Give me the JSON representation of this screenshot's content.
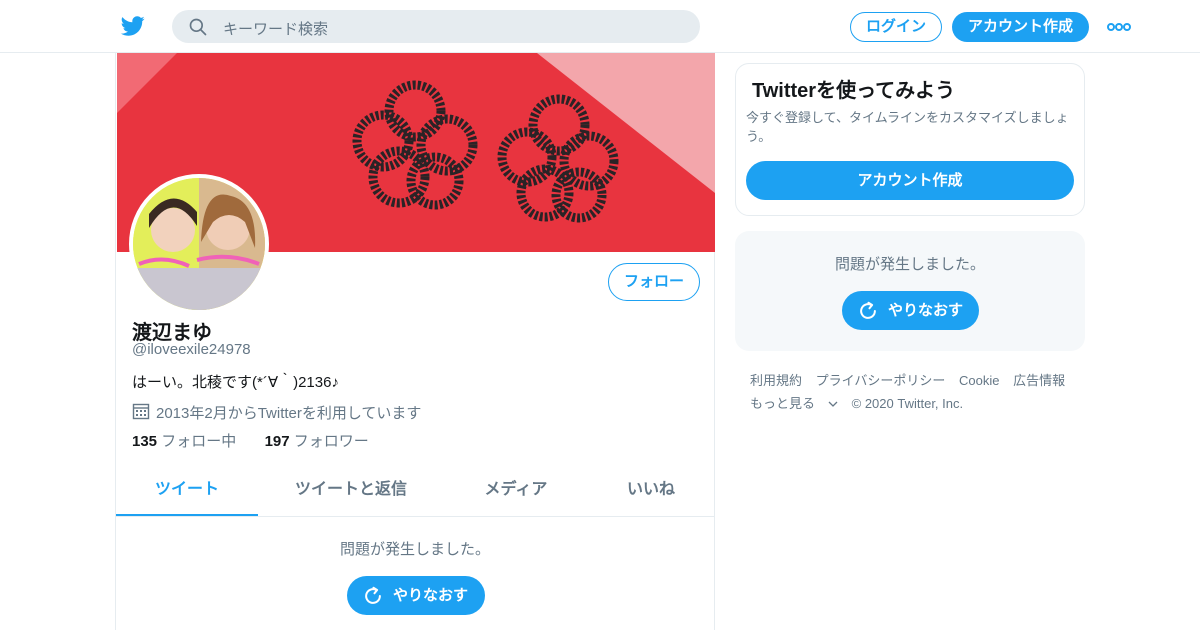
{
  "nav": {
    "search_placeholder": "キーワード検索",
    "login_label": "ログイン",
    "signup_label": "アカウント作成"
  },
  "profile": {
    "follow_label": "フォロー",
    "name": "渡辺まゆ",
    "handle": "@iloveexile24978",
    "bio": "はーい。北稜です(*´∀｀)2136♪",
    "joined": "2013年2月からTwitterを利用しています",
    "following_count": "135",
    "following_label": "フォロー中",
    "followers_count": "197",
    "followers_label": "フォロワー"
  },
  "tabs": [
    "ツイート",
    "ツイートと返信",
    "メディア",
    "いいね"
  ],
  "timeline": {
    "error": "問題が発生しました。",
    "retry_label": "やりなおす"
  },
  "sidebar": {
    "card_title": "Twitterを使ってみよう",
    "card_text": "今すぐ登録して、タイムラインをカスタマイズしましょう。",
    "card_button": "アカウント作成",
    "error": "問題が発生しました。",
    "retry_label": "やりなおす"
  },
  "footer": {
    "links": [
      "利用規約",
      "プライバシーポリシー",
      "Cookie",
      "広告情報"
    ],
    "more": "もっと見る",
    "copyright": "© 2020 Twitter, Inc."
  },
  "colors": {
    "accent": "#1da1f2",
    "banner": "#ea3a47"
  },
  "icons": [
    "twitter-bird-icon",
    "search-icon",
    "more-dots-icon",
    "calendar-icon",
    "refresh-icon",
    "chevron-down-icon"
  ]
}
